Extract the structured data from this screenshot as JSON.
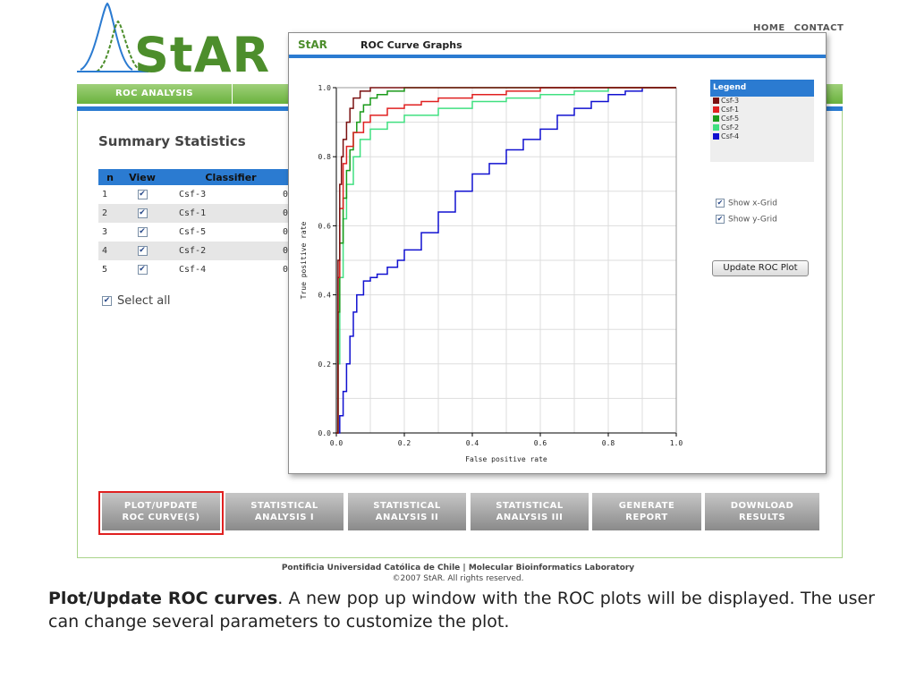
{
  "header": {
    "logo_text": "StAR",
    "top_links": [
      "HOME",
      "CONTACT"
    ]
  },
  "nav": {
    "tab": "ROC ANALYSIS"
  },
  "summary": {
    "title": "Summary Statistics",
    "columns": [
      "n",
      "View",
      "Classifier"
    ],
    "rows": [
      {
        "n": "1",
        "classifier": "Csf-3",
        "more": "0"
      },
      {
        "n": "2",
        "classifier": "Csf-1",
        "more": "0"
      },
      {
        "n": "3",
        "classifier": "Csf-5",
        "more": "0"
      },
      {
        "n": "4",
        "classifier": "Csf-2",
        "more": "0"
      },
      {
        "n": "5",
        "classifier": "Csf-4",
        "more": "0"
      }
    ],
    "checkmark": "✔",
    "select_all": "Select all"
  },
  "buttons": [
    {
      "line1": "PLOT/UPDATE",
      "line2": "ROC CURVE(S)"
    },
    {
      "line1": "STATISTICAL",
      "line2": "ANALYSIS I"
    },
    {
      "line1": "STATISTICAL",
      "line2": "ANALYSIS II"
    },
    {
      "line1": "STATISTICAL",
      "line2": "ANALYSIS III"
    },
    {
      "line1": "GENERATE",
      "line2": "REPORT"
    },
    {
      "line1": "DOWNLOAD",
      "line2": "RESULTS"
    }
  ],
  "footer": {
    "line1": "Pontificia Universidad Católica de Chile  |  Molecular Bioinformatics Laboratory",
    "line2": "©2007 StAR. All rights reserved."
  },
  "caption": {
    "strong": "Plot/Update ROC curves",
    "rest": ". A new pop up window with the ROC plots will be displayed. The user can change several parameters to customize the plot."
  },
  "popup": {
    "brand": "StAR",
    "title": "ROC Curve Graphs",
    "legend_title": "Legend",
    "show_x_grid": "Show x-Grid",
    "show_y_grid": "Show y-Grid",
    "update_button": "Update ROC Plot"
  },
  "colors": {
    "accent_blue": "#2b7bd1",
    "brand_green": "#4d8e2c",
    "highlight_red": "#e02020"
  },
  "chart_data": {
    "type": "line",
    "title": "",
    "xlabel": "False positive rate",
    "ylabel": "True positive rate",
    "xlim": [
      0,
      1
    ],
    "ylim": [
      0,
      1
    ],
    "xticks": [
      "0.0",
      "0.2",
      "0.4",
      "0.6",
      "0.8",
      "1.0"
    ],
    "yticks": [
      "0.0",
      "0.2",
      "0.4",
      "0.6",
      "0.8",
      "1.0"
    ],
    "grid": true,
    "legend": "right",
    "series": [
      {
        "name": "Csf-3",
        "color": "#7a1010",
        "x": [
          0,
          0.005,
          0.01,
          0.015,
          0.02,
          0.03,
          0.04,
          0.05,
          0.07,
          0.1,
          0.15,
          0.3,
          0.5,
          1
        ],
        "y": [
          0,
          0.5,
          0.72,
          0.8,
          0.85,
          0.9,
          0.94,
          0.97,
          0.99,
          1,
          1,
          1,
          1,
          1
        ]
      },
      {
        "name": "Csf-1",
        "color": "#e02020",
        "x": [
          0,
          0.005,
          0.01,
          0.02,
          0.03,
          0.05,
          0.08,
          0.1,
          0.15,
          0.2,
          0.25,
          0.3,
          0.4,
          0.5,
          0.6,
          1
        ],
        "y": [
          0,
          0.45,
          0.65,
          0.78,
          0.83,
          0.87,
          0.9,
          0.92,
          0.94,
          0.95,
          0.96,
          0.97,
          0.98,
          0.99,
          1,
          1
        ]
      },
      {
        "name": "Csf-5",
        "color": "#1a9a1a",
        "x": [
          0,
          0.005,
          0.01,
          0.02,
          0.03,
          0.04,
          0.05,
          0.06,
          0.07,
          0.08,
          0.1,
          0.12,
          0.15,
          0.2,
          1
        ],
        "y": [
          0,
          0.35,
          0.55,
          0.68,
          0.76,
          0.82,
          0.87,
          0.9,
          0.93,
          0.95,
          0.97,
          0.98,
          0.99,
          1,
          1
        ]
      },
      {
        "name": "Csf-2",
        "color": "#40e080",
        "x": [
          0,
          0.005,
          0.01,
          0.02,
          0.03,
          0.05,
          0.07,
          0.1,
          0.15,
          0.2,
          0.3,
          0.4,
          0.5,
          0.6,
          0.7,
          0.8,
          1
        ],
        "y": [
          0,
          0.2,
          0.45,
          0.62,
          0.72,
          0.8,
          0.85,
          0.88,
          0.9,
          0.92,
          0.94,
          0.96,
          0.97,
          0.98,
          0.99,
          1,
          1
        ]
      },
      {
        "name": "Csf-4",
        "color": "#1010d0",
        "x": [
          0,
          0.01,
          0.02,
          0.03,
          0.04,
          0.05,
          0.06,
          0.08,
          0.1,
          0.12,
          0.15,
          0.18,
          0.2,
          0.25,
          0.3,
          0.35,
          0.4,
          0.45,
          0.5,
          0.55,
          0.6,
          0.65,
          0.7,
          0.75,
          0.8,
          0.85,
          0.9,
          1
        ],
        "y": [
          0,
          0.05,
          0.12,
          0.2,
          0.28,
          0.35,
          0.4,
          0.44,
          0.45,
          0.46,
          0.48,
          0.5,
          0.53,
          0.58,
          0.64,
          0.7,
          0.75,
          0.78,
          0.82,
          0.85,
          0.88,
          0.92,
          0.94,
          0.96,
          0.98,
          0.99,
          1,
          1
        ]
      }
    ]
  }
}
